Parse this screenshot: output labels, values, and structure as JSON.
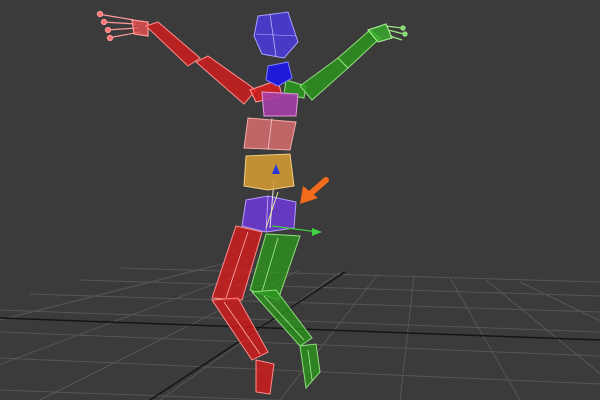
{
  "viewport": {
    "view": "perspective",
    "background_color": "#3b3b3b",
    "grid_visible": true,
    "grid_color": "#5a5a5a",
    "grid_axis_color": "#1a1a1a"
  },
  "rig": {
    "type": "biped",
    "selected_part": "pelvis",
    "colors": {
      "right_side": "#e01f1f",
      "left_side": "#2c9a1e",
      "head": "#4b3bd1",
      "neck": "#1d1bd8",
      "spine_upper": "#a63ea6",
      "spine_mid": "#cf6b6b",
      "spine_low": "#d09a35",
      "pelvis": "#6d3ad0"
    },
    "parts": [
      "head",
      "neck",
      "clavicle-r",
      "clavicle-l",
      "upper-arm-r",
      "forearm-r",
      "hand-r",
      "upper-arm-l",
      "forearm-l",
      "hand-l",
      "spine-upper",
      "spine-mid",
      "spine-low",
      "pelvis",
      "thigh-r",
      "calf-r",
      "foot-r",
      "thigh-l",
      "calf-l",
      "foot-l"
    ]
  },
  "annotation": {
    "type": "arrow",
    "color": "#f26a1b",
    "points_to": "pelvis"
  }
}
